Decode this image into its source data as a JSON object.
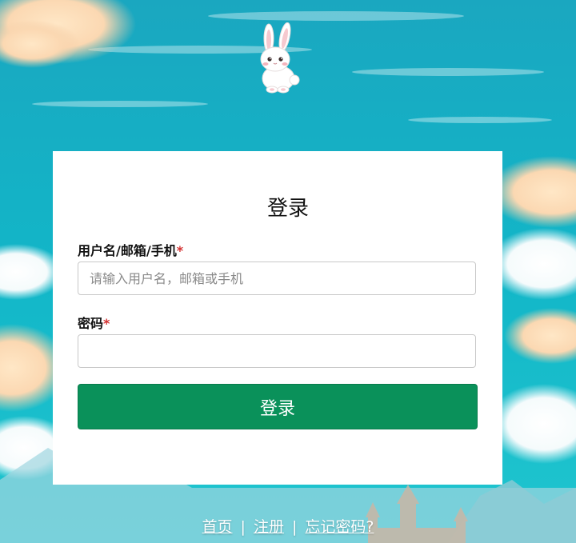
{
  "login": {
    "title": "登录",
    "username_label": "用户名/邮箱/手机",
    "username_required": "*",
    "username_placeholder": "请输入用户名，邮箱或手机",
    "username_value": "",
    "password_label": "密码",
    "password_required": "*",
    "password_value": "",
    "submit_label": "登录"
  },
  "footer": {
    "home": "首页",
    "separator": "|",
    "register": "注册",
    "forgot": "忘记密码?"
  },
  "colors": {
    "accent": "#0a915a",
    "required": "#d32f2f",
    "sky": "#12b2c6"
  },
  "icons": {
    "mascot": "bunny-mascot-icon"
  }
}
